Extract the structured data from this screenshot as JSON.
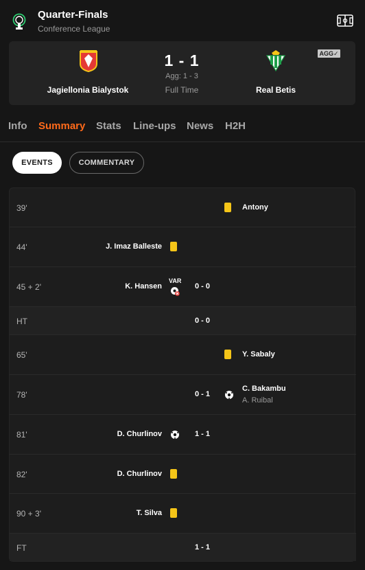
{
  "header": {
    "title": "Quarter-Finals",
    "competition": "Conference League"
  },
  "match": {
    "home_team": "Jagiellonia Bialystok",
    "away_team": "Real Betis",
    "score": "1 - 1",
    "aggregate": "Agg: 1 - 3",
    "status": "Full Time",
    "agg_badge": "AGG✓"
  },
  "tabs": [
    "Info",
    "Summary",
    "Stats",
    "Line-ups",
    "News",
    "H2H"
  ],
  "active_tab": "Summary",
  "toggle": {
    "events": "EVENTS",
    "commentary": "COMMENTARY"
  },
  "colors": {
    "accent": "#ff6a1a",
    "yellow_card": "#f5c518",
    "background": "#161616",
    "card": "#232323"
  },
  "events": [
    {
      "minute": "39'",
      "side": "away",
      "type": "yellow-card",
      "player": "Antony"
    },
    {
      "minute": "44'",
      "side": "home",
      "type": "yellow-card",
      "player": "J. Imaz Balleste"
    },
    {
      "minute": "45 + 2'",
      "side": "home",
      "type": "var-goal-disallowed",
      "player": "K. Hansen",
      "var_label": "VAR",
      "score": "0 - 0"
    },
    {
      "minute": "HT",
      "type": "period",
      "score": "0 - 0"
    },
    {
      "minute": "65'",
      "side": "away",
      "type": "yellow-card",
      "player": "Y. Sabaly"
    },
    {
      "minute": "78'",
      "side": "away",
      "type": "goal",
      "player": "C. Bakambu",
      "assist": "A. Ruibal",
      "score": "0 - 1"
    },
    {
      "minute": "81'",
      "side": "home",
      "type": "goal",
      "player": "D. Churlinov",
      "score": "1 - 1"
    },
    {
      "minute": "82'",
      "side": "home",
      "type": "yellow-card",
      "player": "D. Churlinov"
    },
    {
      "minute": "90 + 3'",
      "side": "home",
      "type": "yellow-card",
      "player": "T. Silva"
    },
    {
      "minute": "FT",
      "type": "period",
      "score": "1 - 1"
    }
  ]
}
